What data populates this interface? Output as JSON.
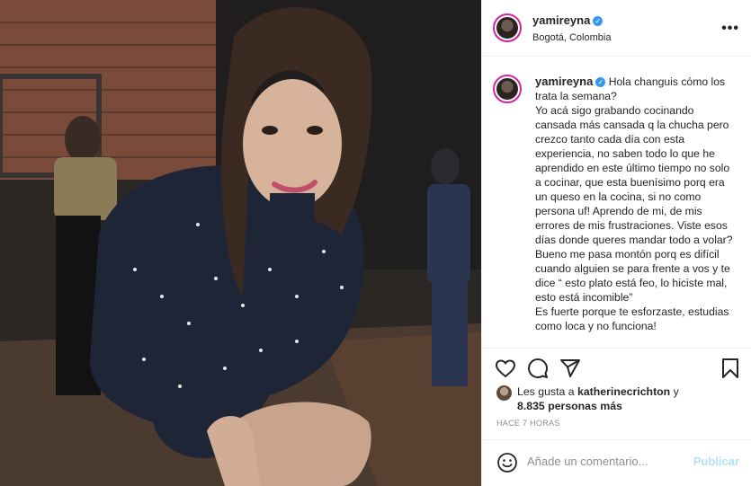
{
  "post": {
    "author": {
      "username": "yamireyna",
      "verified_badge": "✓",
      "location": "Bogotá, Colombia"
    },
    "photo": {
      "description_icon": "photo"
    },
    "caption": {
      "username": "yamireyna",
      "paragraphs": [
        "Hola changuis cómo los trata la semana?",
        "Yo acá sigo grabando cocinando cansada más cansada q la chucha pero crezco tanto cada día con esta experiencia, no saben todo lo que he aprendido en este último tiempo no solo a cocinar, que esta buenísimo porq era un queso en la cocina, si no como persona uf! Aprendo de mi, de mis errores de mis frustraciones. Viste esos días donde queres mandar todo a volar? Bueno me pasa montón porq es difícil cuando alguien se para frente a vos y te dice “ esto plato está feo, lo hiciste mal, esto está incomible”",
        "Es fuerte porque te esforzaste, estudias como loca y no funciona!"
      ]
    },
    "likes": {
      "prefix": "Les gusta a ",
      "user": "katherinecrichton",
      "middle": " y",
      "count_text": "8.835 personas más"
    },
    "timestamp": "HACE 7 HORAS",
    "comment": {
      "placeholder": "Añade un comentario...",
      "publish_label": "Publicar"
    },
    "icons": {
      "like": "heart-icon",
      "comment": "comment-icon",
      "share": "share-icon",
      "save": "bookmark-icon",
      "emoji": "emoji-icon",
      "more": "more-options-icon"
    }
  }
}
